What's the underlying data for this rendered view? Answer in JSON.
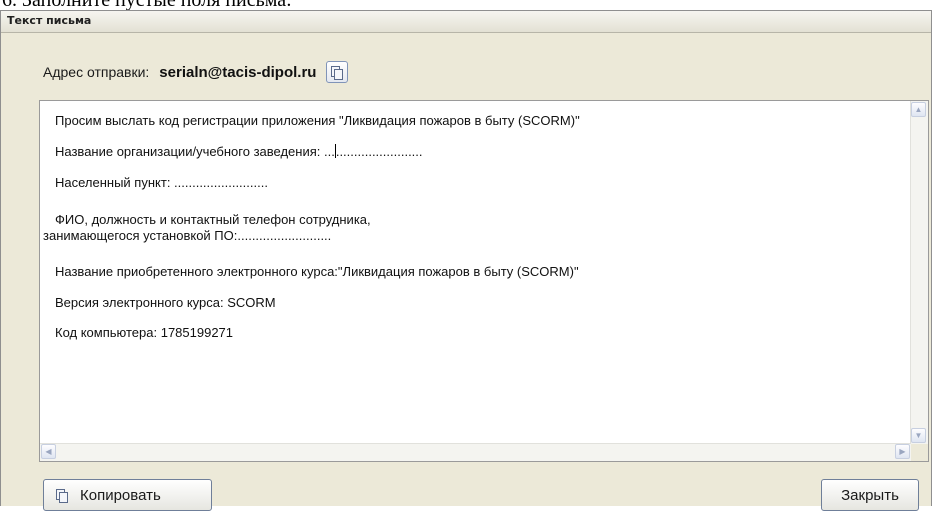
{
  "caption": "6. Заполните пустые поля письма:",
  "window": {
    "title": "Текст письма"
  },
  "address": {
    "label": "Адрес отправки:",
    "value": "serialn@tacis-dipol.ru",
    "copy_icon": "copy-icon"
  },
  "body": {
    "line1": "Просим выслать код регистрации приложения \"Ликвидация пожаров в быту (SCORM)\"",
    "line2_prefix": "Название организации/учебного заведения: ...",
    "line2_suffix": "........................",
    "line3": "Населенный пункт: ..........................",
    "line4a": "ФИО, должность и контактный телефон сотрудника,",
    "line4b": "занимающегося установкой ПО:..........................",
    "line5": "Название приобретенного электронного курса:\"Ликвидация пожаров в быту (SCORM)\"",
    "line6": "Версия электронного курса: SCORM",
    "line7": "Код компьютера: 1785199271"
  },
  "scrollbar_icons": {
    "up": "▲",
    "down": "▼",
    "left": "◀",
    "right": "▶"
  },
  "buttons": {
    "copy": "Копировать",
    "close": "Закрыть"
  }
}
